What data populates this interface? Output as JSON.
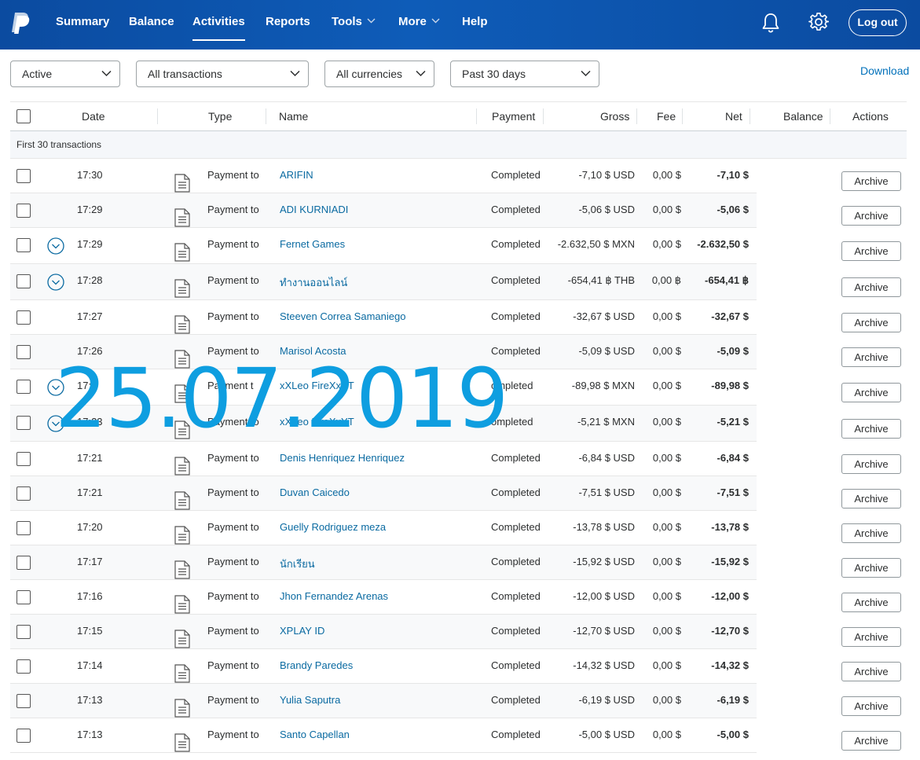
{
  "nav": {
    "items": [
      {
        "label": "Summary",
        "active": false,
        "caret": false
      },
      {
        "label": "Balance",
        "active": false,
        "caret": false
      },
      {
        "label": "Activities",
        "active": true,
        "caret": false
      },
      {
        "label": "Reports",
        "active": false,
        "caret": false
      },
      {
        "label": "Tools",
        "active": false,
        "caret": true
      },
      {
        "label": "More",
        "active": false,
        "caret": true
      },
      {
        "label": "Help",
        "active": false,
        "caret": false
      }
    ],
    "logout_label": "Log out"
  },
  "filters": {
    "status": "Active",
    "type": "All transactions",
    "currency": "All currencies",
    "period": "Past 30 days",
    "download_label": "Download"
  },
  "table": {
    "headers": {
      "date": "Date",
      "type": "Type",
      "name": "Name",
      "payment": "Payment",
      "gross": "Gross",
      "fee": "Fee",
      "net": "Net",
      "balance": "Balance",
      "actions": "Actions"
    },
    "group_label": "First 30 transactions",
    "archive_label": "Archive",
    "rows": [
      {
        "time": "17:30",
        "type": "Payment to",
        "name": "ARIFIN",
        "status": "Completed",
        "gross": "-7,10 $ USD",
        "fee": "0,00 $",
        "net": "-7,10 $",
        "expand": false
      },
      {
        "time": "17:29",
        "type": "Payment to",
        "name": "ADI KURNIADI",
        "status": "Completed",
        "gross": "-5,06 $ USD",
        "fee": "0,00 $",
        "net": "-5,06 $",
        "expand": false
      },
      {
        "time": "17:29",
        "type": "Payment to",
        "name": "Fernet Games",
        "status": "Completed",
        "gross": "-2.632,50 $ MXN",
        "fee": "0,00 $",
        "net": "-2.632,50 $",
        "expand": true
      },
      {
        "time": "17:28",
        "type": "Payment to",
        "name": "ทำงานออนไลน์",
        "status": "Completed",
        "gross": "-654,41 ฿ THB",
        "fee": "0,00 ฿",
        "net": "-654,41 ฿",
        "expand": true
      },
      {
        "time": "17:27",
        "type": "Payment to",
        "name": "Steeven Correa Samaniego",
        "status": "Completed",
        "gross": "-32,67 $ USD",
        "fee": "0,00 $",
        "net": "-32,67 $",
        "expand": false
      },
      {
        "time": "17:26",
        "type": "Payment to",
        "name": "Marisol Acosta",
        "status": "Completed",
        "gross": "-5,09 $ USD",
        "fee": "0,00 $",
        "net": "-5,09 $",
        "expand": false
      },
      {
        "time": "17:2",
        "type": "Payment t",
        "name": "xXLeo FireXxYT",
        "status": "ompleted",
        "gross": "-89,98 $ MXN",
        "fee": "0,00 $",
        "net": "-89,98 $",
        "expand": true
      },
      {
        "time": "17:23",
        "type": "Payment to",
        "name": "xXLeo FireXxYT",
        "status": "ompleted",
        "gross": "-5,21 $ MXN",
        "fee": "0,00 $",
        "net": "-5,21 $",
        "expand": true
      },
      {
        "time": "17:21",
        "type": "Payment to",
        "name": "Denis Henriquez Henriquez",
        "status": "Completed",
        "gross": "-6,84 $ USD",
        "fee": "0,00 $",
        "net": "-6,84 $",
        "expand": false
      },
      {
        "time": "17:21",
        "type": "Payment to",
        "name": "Duvan Caicedo",
        "status": "Completed",
        "gross": "-7,51 $ USD",
        "fee": "0,00 $",
        "net": "-7,51 $",
        "expand": false
      },
      {
        "time": "17:20",
        "type": "Payment to",
        "name": "Guelly Rodriguez meza",
        "status": "Completed",
        "gross": "-13,78 $ USD",
        "fee": "0,00 $",
        "net": "-13,78 $",
        "expand": false
      },
      {
        "time": "17:17",
        "type": "Payment to",
        "name": "นักเรียน",
        "status": "Completed",
        "gross": "-15,92 $ USD",
        "fee": "0,00 $",
        "net": "-15,92 $",
        "expand": false
      },
      {
        "time": "17:16",
        "type": "Payment to",
        "name": "Jhon Fernandez Arenas",
        "status": "Completed",
        "gross": "-12,00 $ USD",
        "fee": "0,00 $",
        "net": "-12,00 $",
        "expand": false
      },
      {
        "time": "17:15",
        "type": "Payment to",
        "name": "XPLAY ID",
        "status": "Completed",
        "gross": "-12,70 $ USD",
        "fee": "0,00 $",
        "net": "-12,70 $",
        "expand": false
      },
      {
        "time": "17:14",
        "type": "Payment to",
        "name": "Brandy Paredes",
        "status": "Completed",
        "gross": "-14,32 $ USD",
        "fee": "0,00 $",
        "net": "-14,32 $",
        "expand": false
      },
      {
        "time": "17:13",
        "type": "Payment to",
        "name": "Yulia Saputra",
        "status": "Completed",
        "gross": "-6,19 $ USD",
        "fee": "0,00 $",
        "net": "-6,19 $",
        "expand": false
      },
      {
        "time": "17:13",
        "type": "Payment to",
        "name": "Santo Capellan",
        "status": "Completed",
        "gross": "-5,00 $ USD",
        "fee": "0,00 $",
        "net": "-5,00 $",
        "expand": false
      }
    ]
  },
  "overlay_date": "25.07.2019",
  "colors": {
    "nav_bg": "#0b4ba0",
    "link": "#0a6aa1",
    "overlay": "#0e9ee0"
  },
  "icons": [
    "paypal-logo-icon",
    "bell-icon",
    "gear-icon",
    "chevron-down-icon",
    "document-icon",
    "expand-circle-icon"
  ]
}
